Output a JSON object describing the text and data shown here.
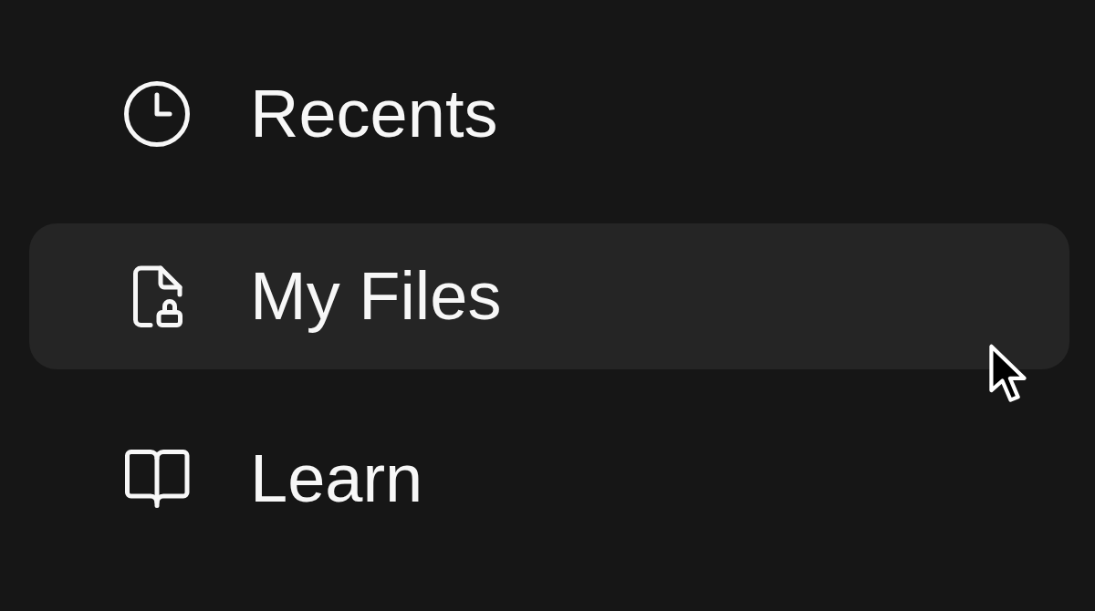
{
  "nav": {
    "items": [
      {
        "label": "Recents",
        "selected": false
      },
      {
        "label": "My Files",
        "selected": true
      },
      {
        "label": "Learn",
        "selected": false
      }
    ]
  }
}
